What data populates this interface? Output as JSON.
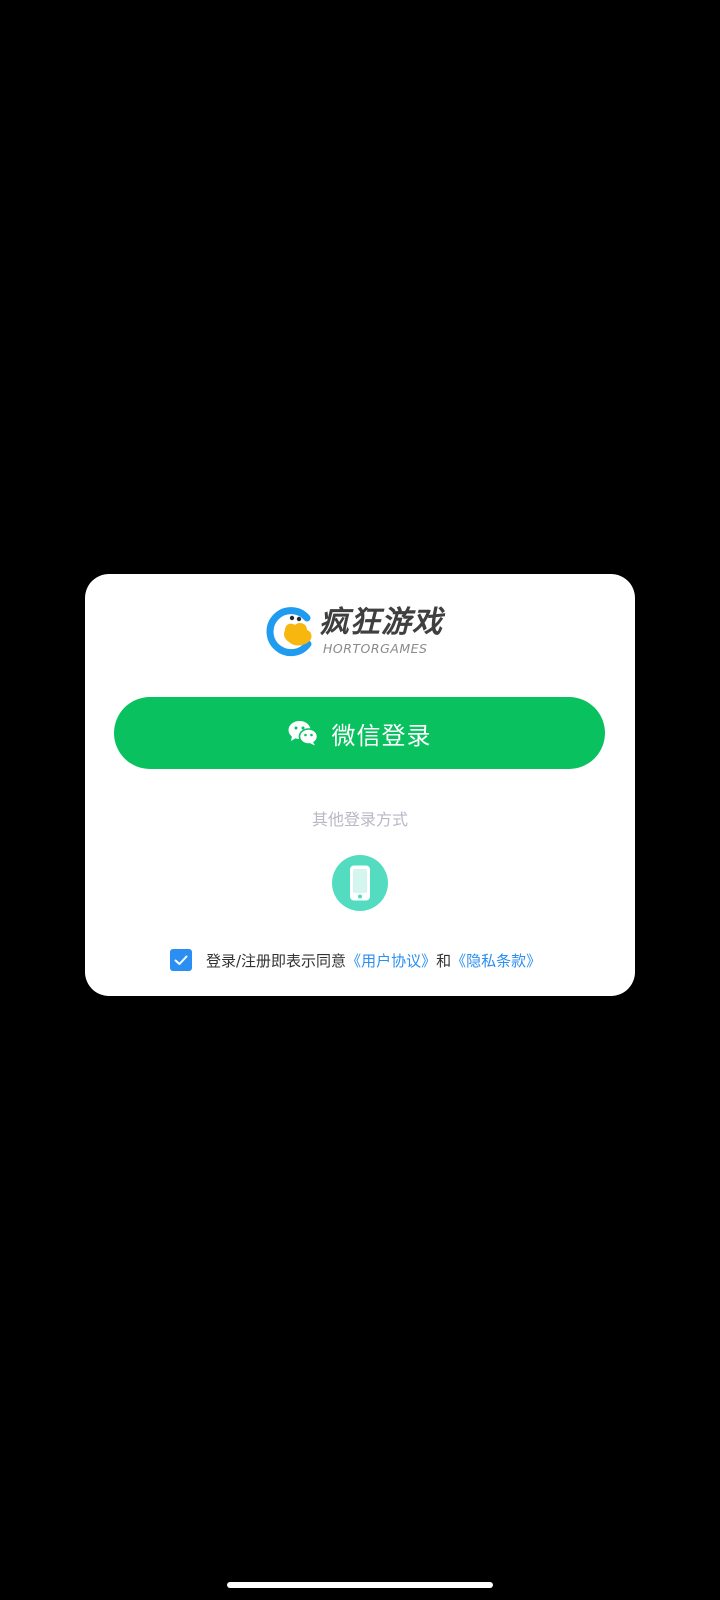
{
  "dialog": {
    "logo": {
      "name_cn": "疯狂游戏",
      "name_en": "HORTORGAMES",
      "colors": {
        "blue": "#1f9bf0",
        "yellow": "#f7b70f",
        "text": "#3f3f3f"
      }
    },
    "wechat_login": {
      "label": "微信登录",
      "icon": "wechat-icon",
      "color": "#0ac160"
    },
    "other_login": {
      "label": "其他登录方式",
      "phone_icon": "phone-icon",
      "color": "#54dcc0"
    },
    "agreement": {
      "checked": true,
      "prefix": "登录/注册即表示同意",
      "user_agreement": "《用户协议》",
      "and": "和",
      "privacy_policy": "《隐私条款》",
      "link_color": "#2a8ef2"
    }
  }
}
